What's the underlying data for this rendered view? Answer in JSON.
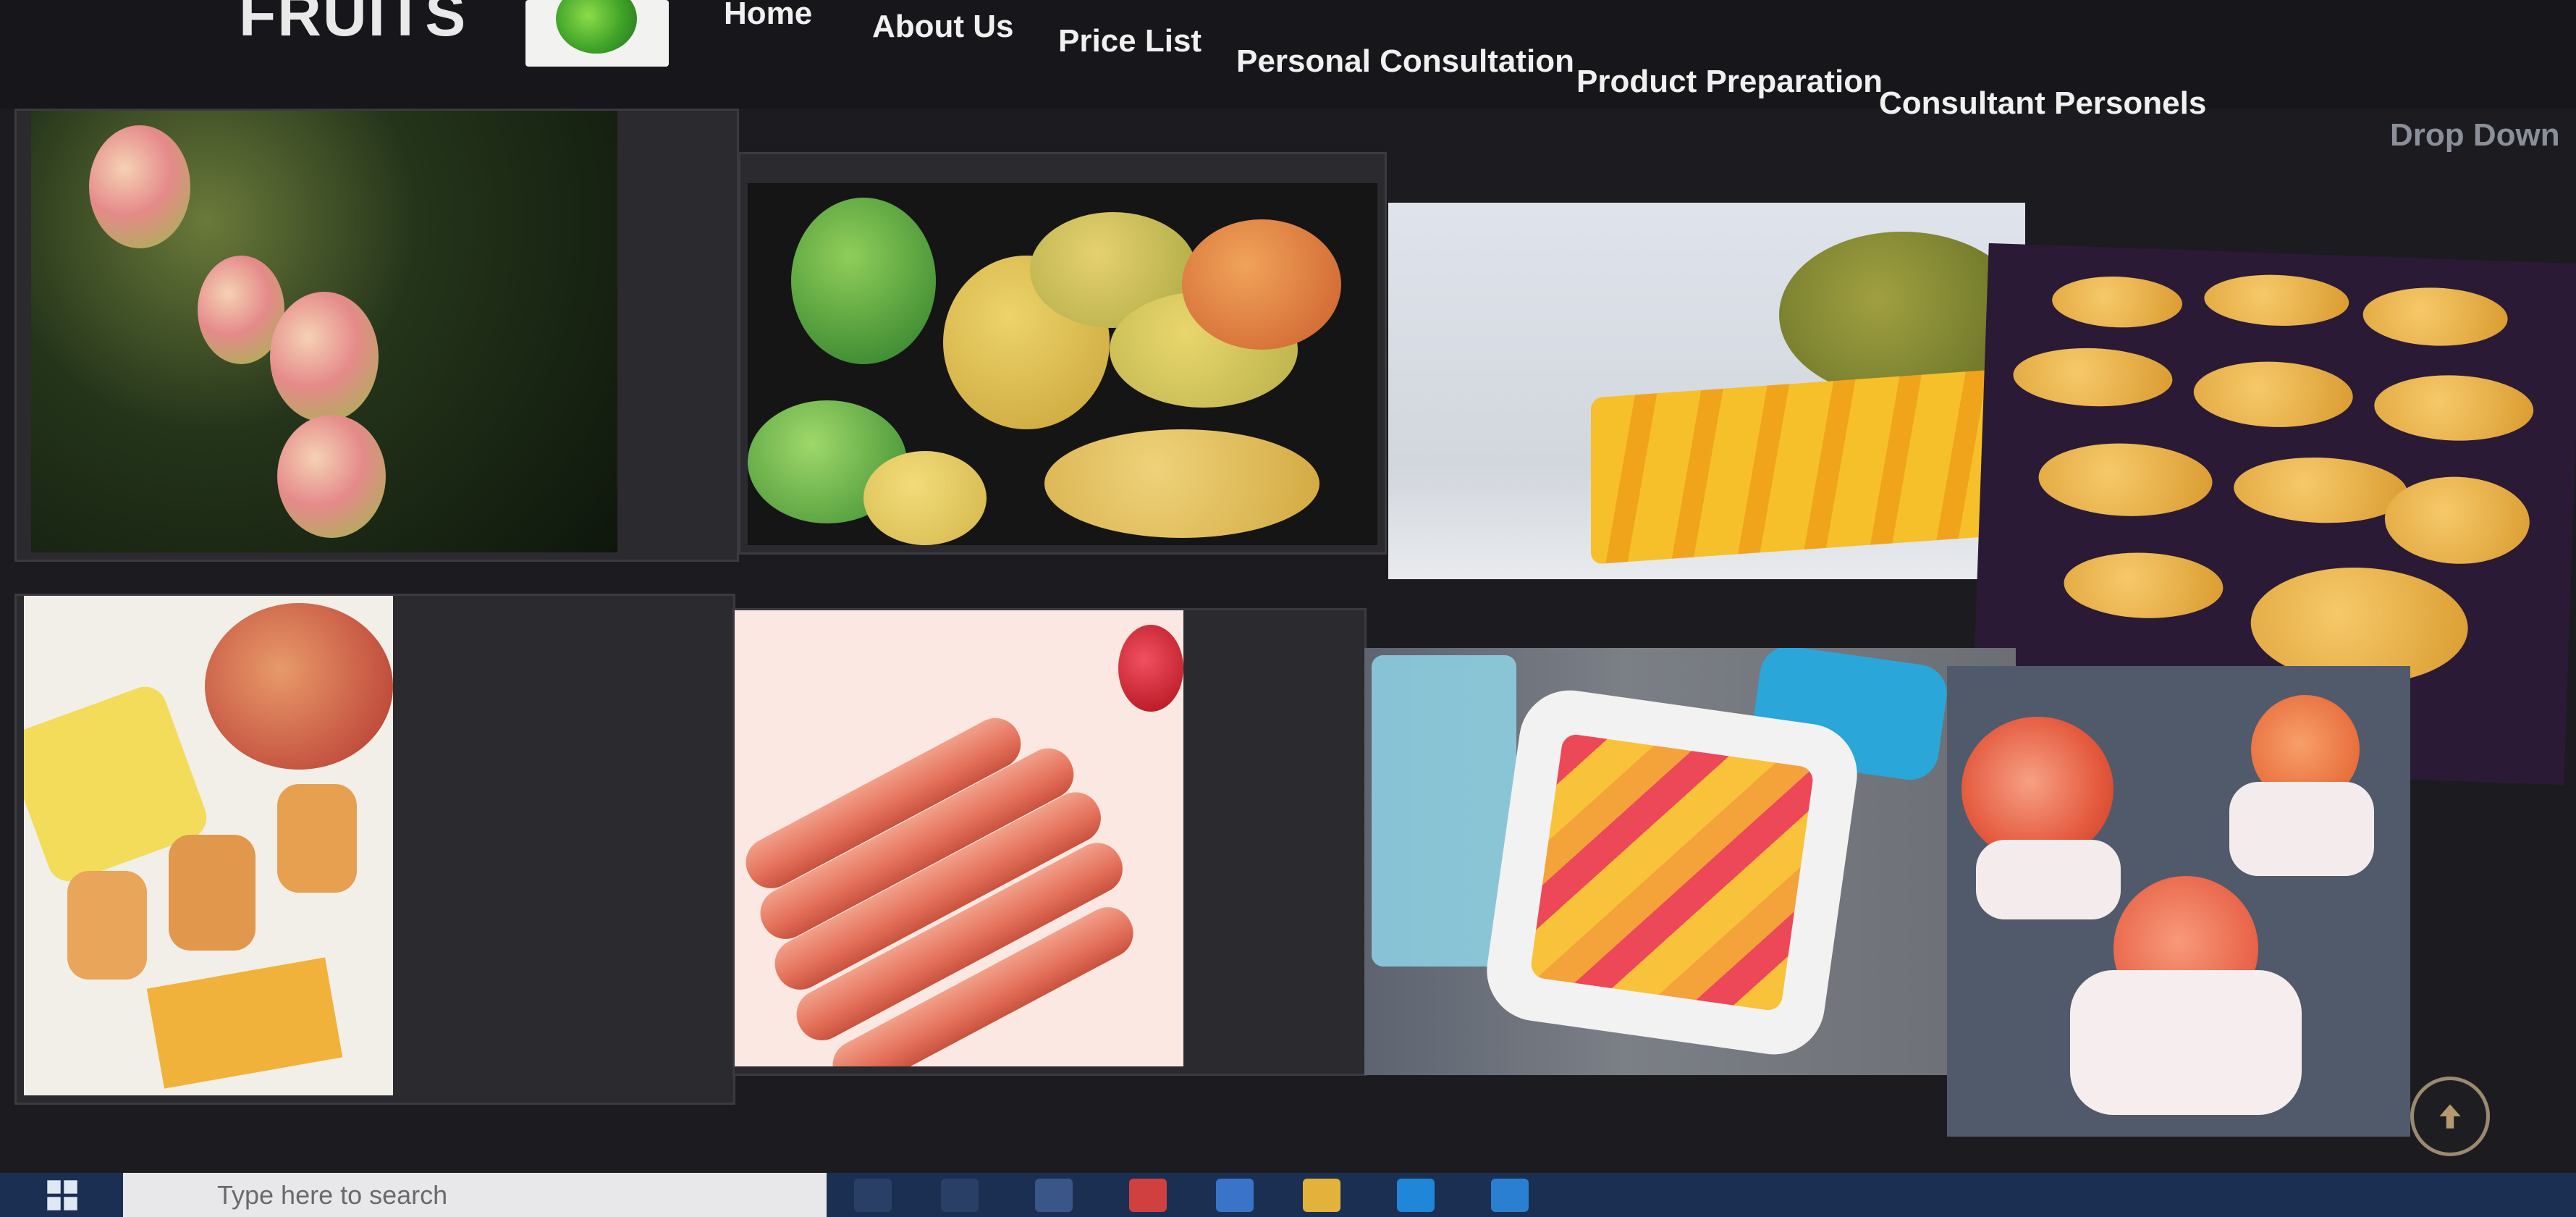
{
  "brand": {
    "name": "FRUITS",
    "logo_icon": "leaf-logo-icon"
  },
  "nav": {
    "items": [
      {
        "label": "Home",
        "state": "normal"
      },
      {
        "label": "About Us",
        "state": "normal"
      },
      {
        "label": "Price List",
        "state": "normal"
      },
      {
        "label": "Personal Consultation",
        "state": "normal"
      },
      {
        "label": "Product Preparation",
        "state": "normal"
      },
      {
        "label": "Consultant Personels",
        "state": "normal"
      },
      {
        "label": "",
        "state": "active"
      },
      {
        "label": "Drop Down",
        "state": "dim"
      }
    ],
    "active_color": "#b34a2a"
  },
  "gallery": {
    "photos": [
      {
        "subject": "mango-tree-photo"
      },
      {
        "subject": "mango-pile-photo"
      },
      {
        "subject": "dried-mango-photo"
      },
      {
        "subject": "mango-tray-photo"
      },
      {
        "subject": "mango-rolls-photo"
      },
      {
        "subject": "fruit-leather-photo"
      },
      {
        "subject": "mango-plate-photo"
      },
      {
        "subject": "rose-cupcakes-photo"
      }
    ]
  },
  "scroll_top": {
    "icon": "arrow-up-icon"
  },
  "taskbar": {
    "search_placeholder": "Type here to search",
    "clock": ""
  }
}
